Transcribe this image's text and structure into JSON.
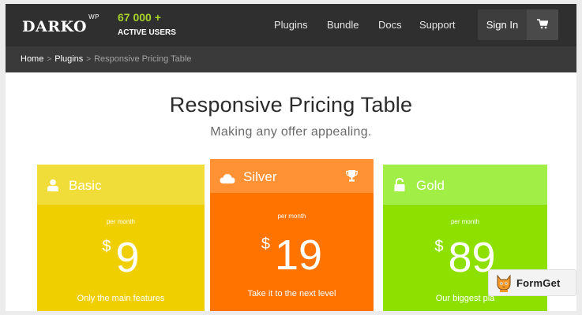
{
  "header": {
    "brand": "DARKO",
    "brand_sup": "WP",
    "users_count": "67 000 +",
    "users_label": "ACTIVE USERS",
    "nav": [
      {
        "label": "Plugins"
      },
      {
        "label": "Bundle"
      },
      {
        "label": "Docs"
      },
      {
        "label": "Support"
      }
    ],
    "signin_label": "Sign In",
    "cart_icon": "cart-icon"
  },
  "breadcrumb": {
    "items": [
      "Home",
      "Plugins"
    ],
    "current": "Responsive Pricing Table"
  },
  "hero": {
    "title": "Responsive Pricing Table",
    "subtitle": "Making any offer appealing."
  },
  "plans": [
    {
      "name": "Basic",
      "icon": "user-icon",
      "period": "per month",
      "currency": "$",
      "amount": "9",
      "description": "Only the main features",
      "head_color": "#f1dd3a",
      "body_color": "#f0cf00"
    },
    {
      "name": "Silver",
      "icon": "cloud-icon",
      "badge_icon": "trophy-icon",
      "period": "per month",
      "currency": "$",
      "amount": "19",
      "description": "Take it to the next level",
      "head_color": "#ff9234",
      "body_color": "#ff7400"
    },
    {
      "name": "Gold",
      "icon": "lock-icon",
      "period": "per month",
      "currency": "$",
      "amount": "89",
      "description": "Our biggest pla",
      "head_color": "#a1ef46",
      "body_color": "#8ee000"
    }
  ],
  "watermark": {
    "label": "FormGet",
    "icon": "formget-cat-icon"
  },
  "colors": {
    "topbar": "#2f2f2f",
    "accent_green": "#a6d22b",
    "crumbbar": "#3a3a3a"
  }
}
